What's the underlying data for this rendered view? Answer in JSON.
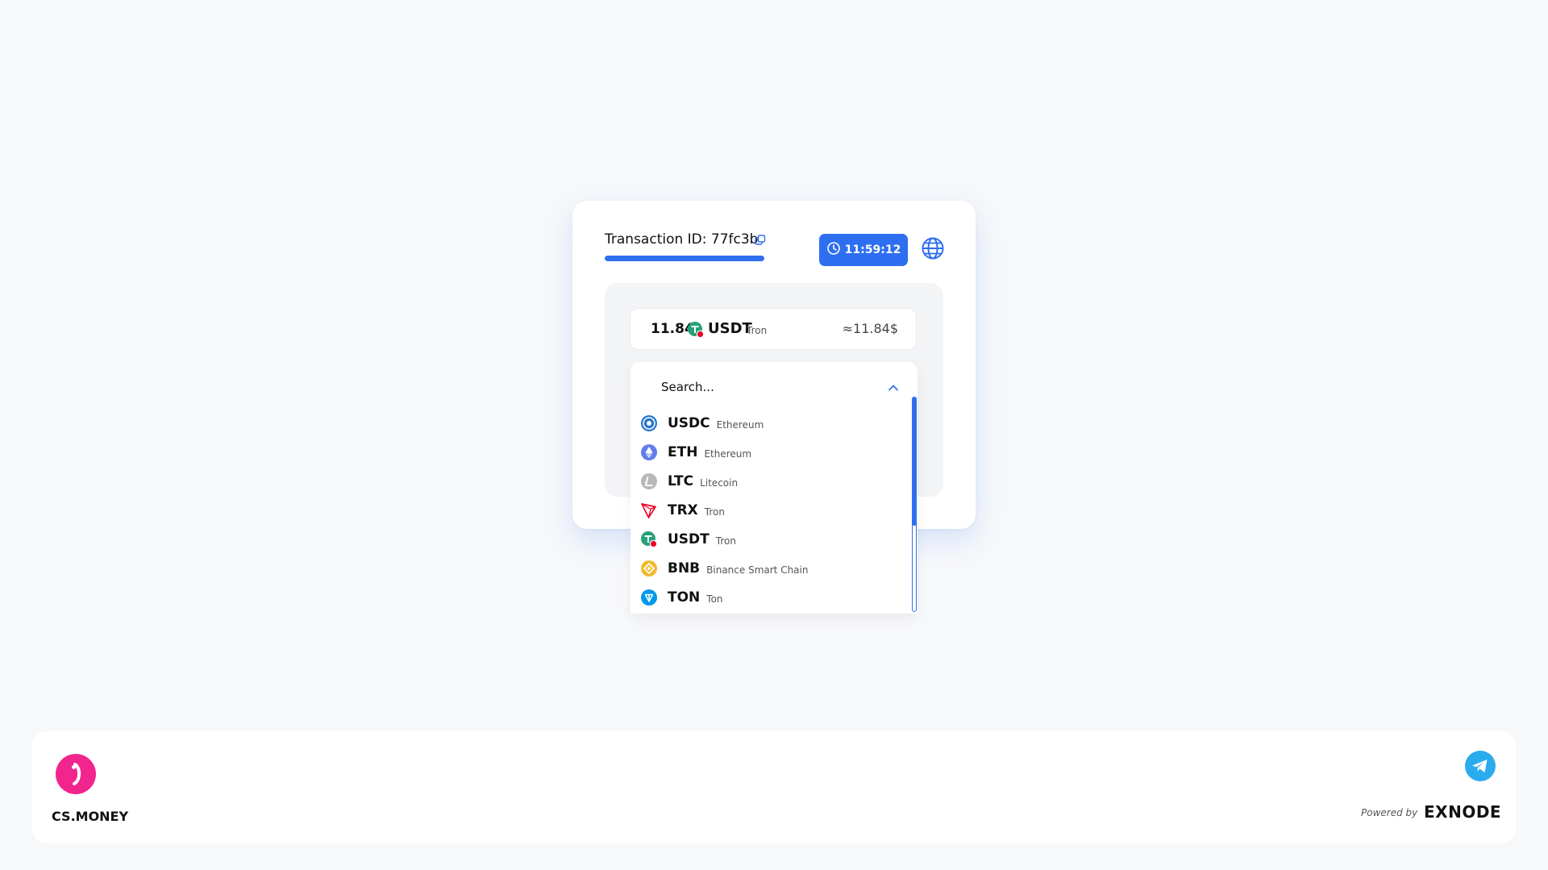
{
  "transaction": {
    "label": "Transaction ID: 77fc3b",
    "progress_fraction": 1.0,
    "timer": "11:59:12"
  },
  "amount": {
    "value": "11.84",
    "symbol": "USDT",
    "network": "Tron",
    "usd": "≈11.84$"
  },
  "search": {
    "placeholder": "Search..."
  },
  "currencies": [
    {
      "symbol": "USDC",
      "network": "Ethereum",
      "icon": "usdc-icon"
    },
    {
      "symbol": "ETH",
      "network": "Ethereum",
      "icon": "eth-icon"
    },
    {
      "symbol": "LTC",
      "network": "Litecoin",
      "icon": "ltc-icon"
    },
    {
      "symbol": "TRX",
      "network": "Tron",
      "icon": "trx-icon"
    },
    {
      "symbol": "USDT",
      "network": "Tron",
      "icon": "usdt-icon"
    },
    {
      "symbol": "BNB",
      "network": "Binance Smart Chain",
      "icon": "bnb-icon"
    },
    {
      "symbol": "TON",
      "network": "Ton",
      "icon": "ton-icon"
    }
  ],
  "scroll": {
    "thumb_fraction": 0.6
  },
  "footer": {
    "brand": "CS.MONEY",
    "powered_by": "Powered by",
    "exnode": "EXNODE"
  },
  "colors": {
    "accent": "#2e6ef0",
    "brand_pink": "#f2248e",
    "telegram": "#2aabee",
    "background": "#f7f8fa"
  }
}
